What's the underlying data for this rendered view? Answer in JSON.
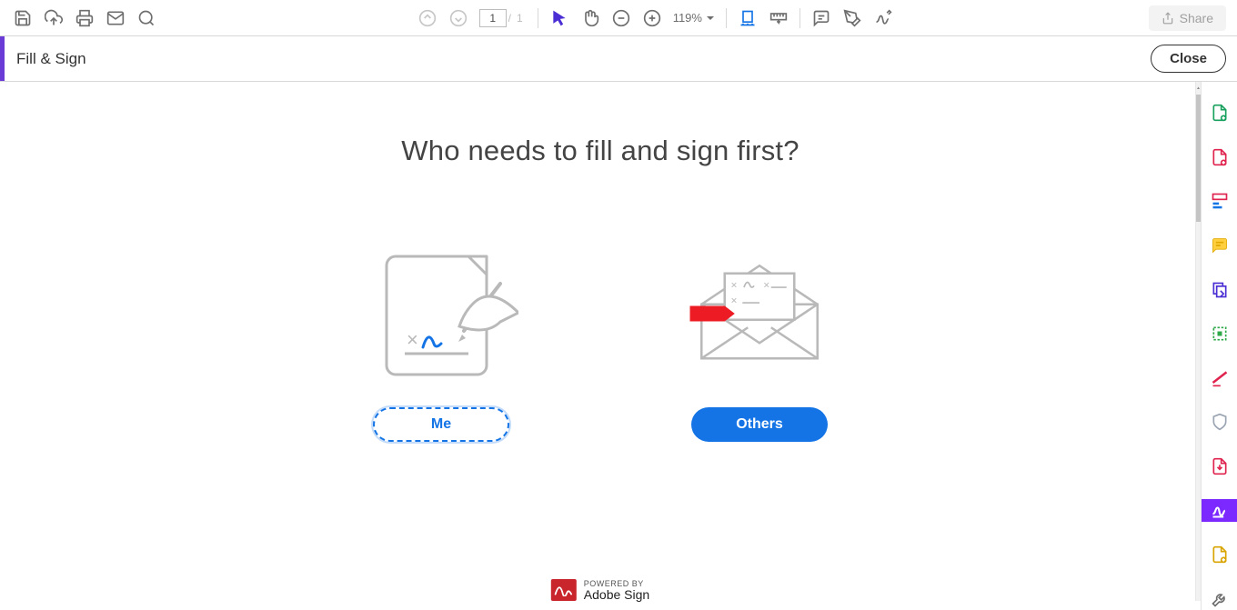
{
  "toolbar": {
    "page_current": "1",
    "page_total": "1",
    "zoom": "119%",
    "share_label": "Share"
  },
  "subheader": {
    "title": "Fill & Sign",
    "close_label": "Close"
  },
  "main": {
    "question": "Who needs to fill and sign first?",
    "me_label": "Me",
    "others_label": "Others"
  },
  "footer": {
    "powered_small": "POWERED BY",
    "powered_big": "Adobe Sign"
  }
}
